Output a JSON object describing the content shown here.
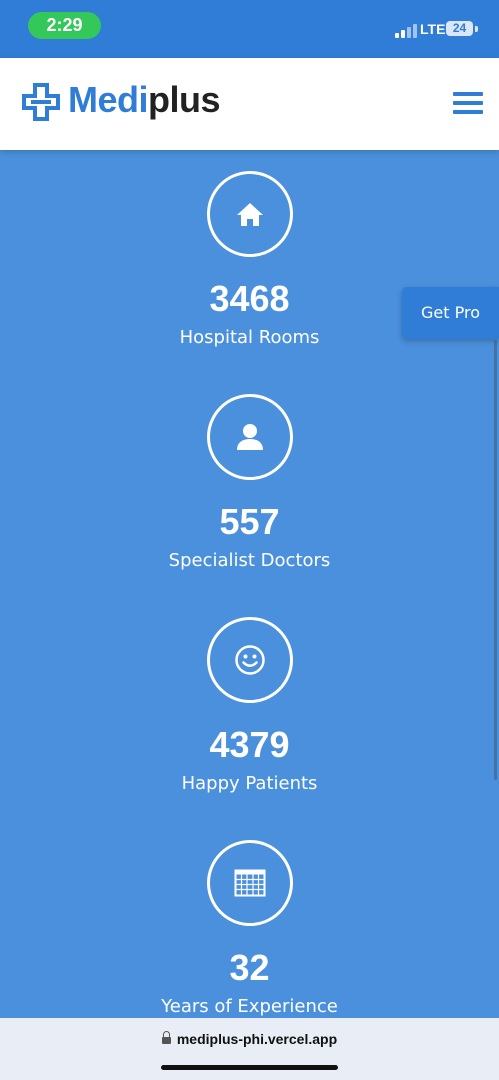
{
  "status_bar": {
    "time": "2:29",
    "network": "LTE",
    "battery": "24"
  },
  "header": {
    "brand_part1": "Medi",
    "brand_part2": "plus",
    "logo_icon": "medical-cross-icon",
    "menu_icon": "hamburger-menu-icon"
  },
  "stats": [
    {
      "icon": "home-icon",
      "value": "3468",
      "label": "Hospital Rooms"
    },
    {
      "icon": "user-icon",
      "value": "557",
      "label": "Specialist Doctors"
    },
    {
      "icon": "smiley-icon",
      "value": "4379",
      "label": "Happy Patients"
    },
    {
      "icon": "calendar-grid-icon",
      "value": "32",
      "label": "Years of Experience"
    }
  ],
  "floating_button": {
    "label": "Get Pro"
  },
  "browser": {
    "url": "mediplus-phi.vercel.app"
  },
  "colors": {
    "accent": "#2f7dd7",
    "section_bg": "#4a90dc",
    "status_pill": "#34c759",
    "brand_dark": "#222222"
  }
}
